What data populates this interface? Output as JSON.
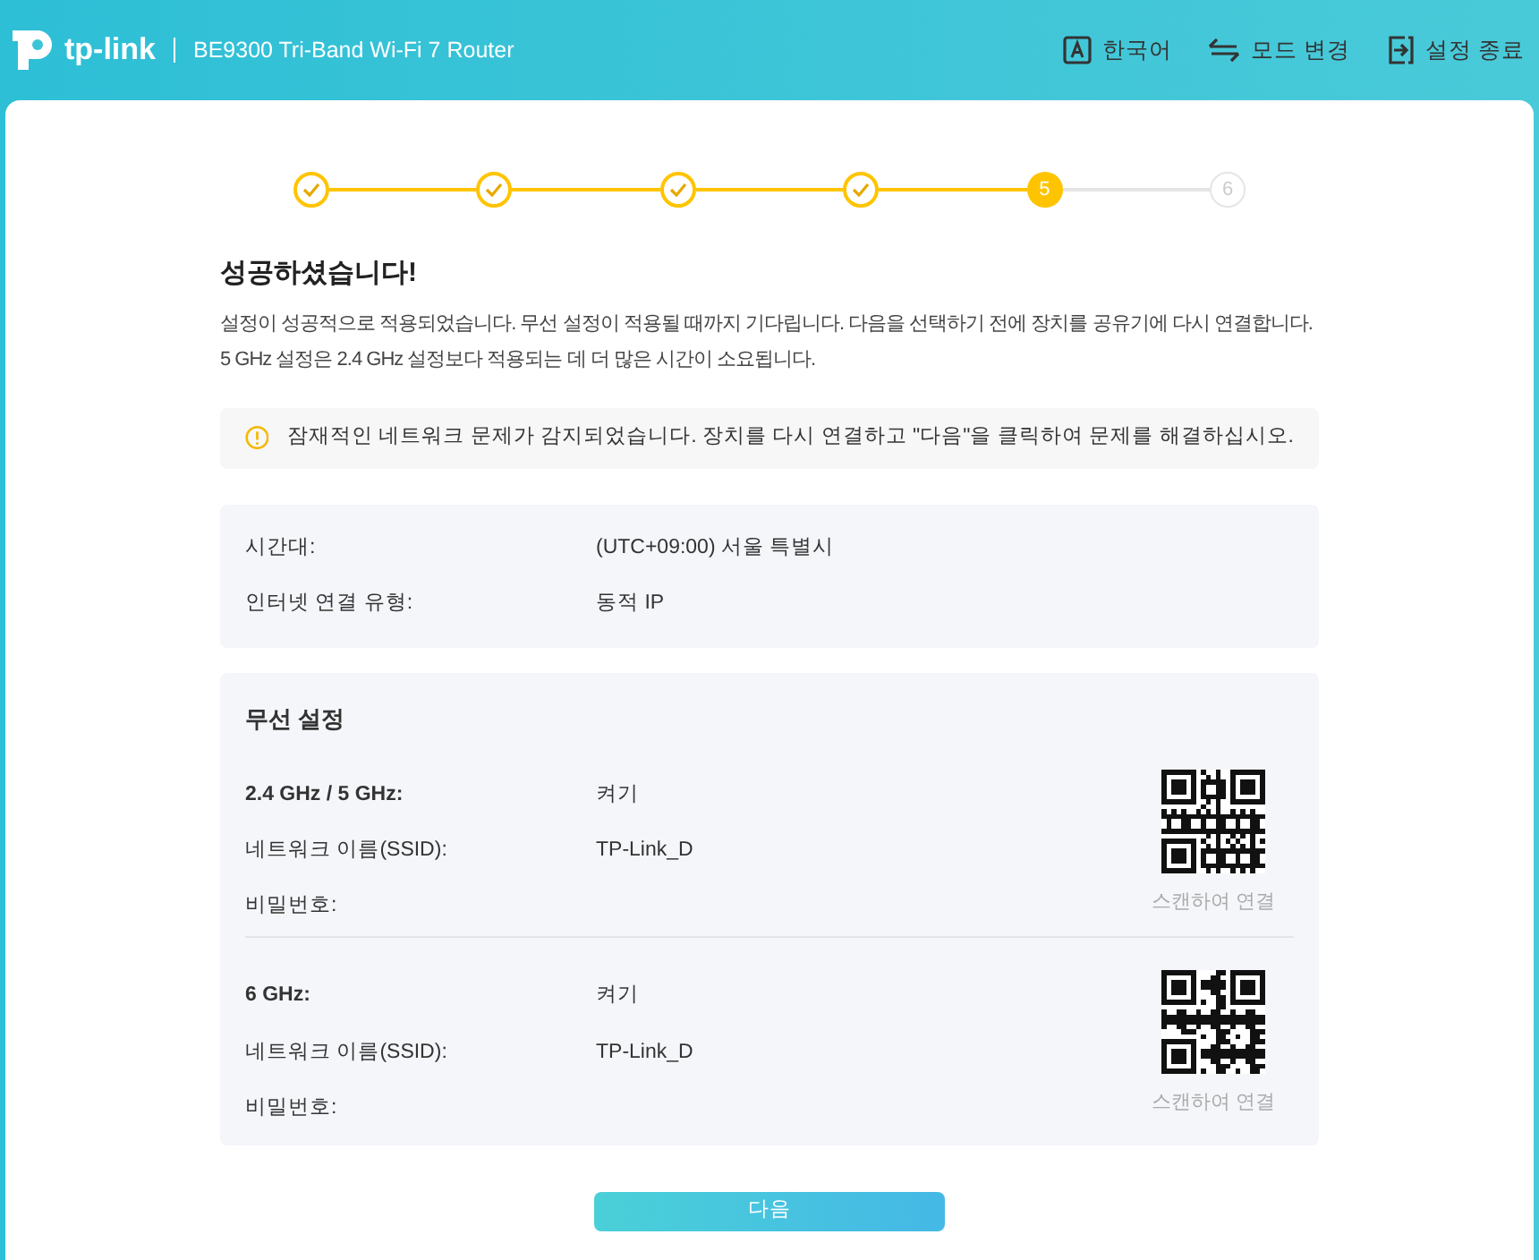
{
  "header": {
    "logo": "tp-link",
    "model": "BE9300 Tri-Band Wi-Fi 7 Router",
    "actions": [
      {
        "kind": "language",
        "label": "한국어"
      },
      {
        "kind": "mode",
        "label": "모드 변경"
      },
      {
        "kind": "exit",
        "label": "설정 종료"
      }
    ]
  },
  "steps": [
    {
      "kind": "done"
    },
    {
      "kind": "done"
    },
    {
      "kind": "done"
    },
    {
      "kind": "done"
    },
    {
      "kind": "current",
      "label": "5"
    },
    {
      "kind": "pending",
      "label": "6"
    }
  ],
  "title": "성공하셨습니다!",
  "description": [
    "설정이 성공적으로 적용되었습니다. 무선 설정이 적용될 때까지 기다립니다. 다음을 선택하기 전에 장치를 공유기에 다시 연결합니다.",
    "5 GHz 설정은 2.4 GHz 설정보다 적용되는 데 더 많은 시간이 소요됩니다."
  ],
  "warning": "잠재적인 네트워크 문제가 감지되었습니다. 장치를 다시 연결하고 \"다음\"을 클릭하여 문제를 해결하십시오.",
  "summary": [
    {
      "label": "시간대:",
      "value": "(UTC+09:00) 서울 특별시"
    },
    {
      "label": "인터넷 연결 유형:",
      "value": "동적 IP"
    }
  ],
  "wireless": {
    "title": "무선 설정",
    "bands": [
      {
        "band": "2.4 GHz / 5 GHz:",
        "status": "켜기",
        "ssid_label": "네트워크 이름(SSID):",
        "ssid": "TP-Link_D",
        "password_label": "비밀번호:",
        "qr_caption": "스캔하여 연결"
      },
      {
        "band": "6 GHz:",
        "status": "켜기",
        "ssid_label": "네트워크 이름(SSID):",
        "ssid": "TP-Link_D",
        "password_label": "비밀번호:",
        "qr_caption": "스캔하여 연결"
      }
    ]
  },
  "next_button": "다음"
}
